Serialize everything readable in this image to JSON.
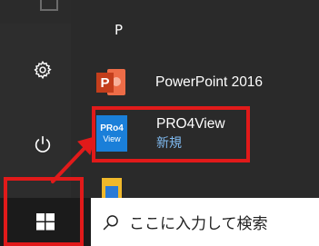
{
  "start_menu": {
    "group_letter": "P",
    "apps": [
      {
        "label": "PowerPoint 2016",
        "icon": "powerpoint-icon",
        "tile_letter": "P"
      },
      {
        "label": "PRO4View",
        "sub_label": "新規",
        "icon": "pro4view-icon",
        "tile_line1": "PRo4",
        "tile_line2": "View"
      }
    ]
  },
  "taskbar": {
    "search_placeholder": "ここに入力して検索"
  },
  "colors": {
    "highlight": "#e11a1a",
    "powerpoint": "#c43e1c",
    "pro4view_tile": "#1a7fd9",
    "new_label": "#7fbaf0"
  }
}
